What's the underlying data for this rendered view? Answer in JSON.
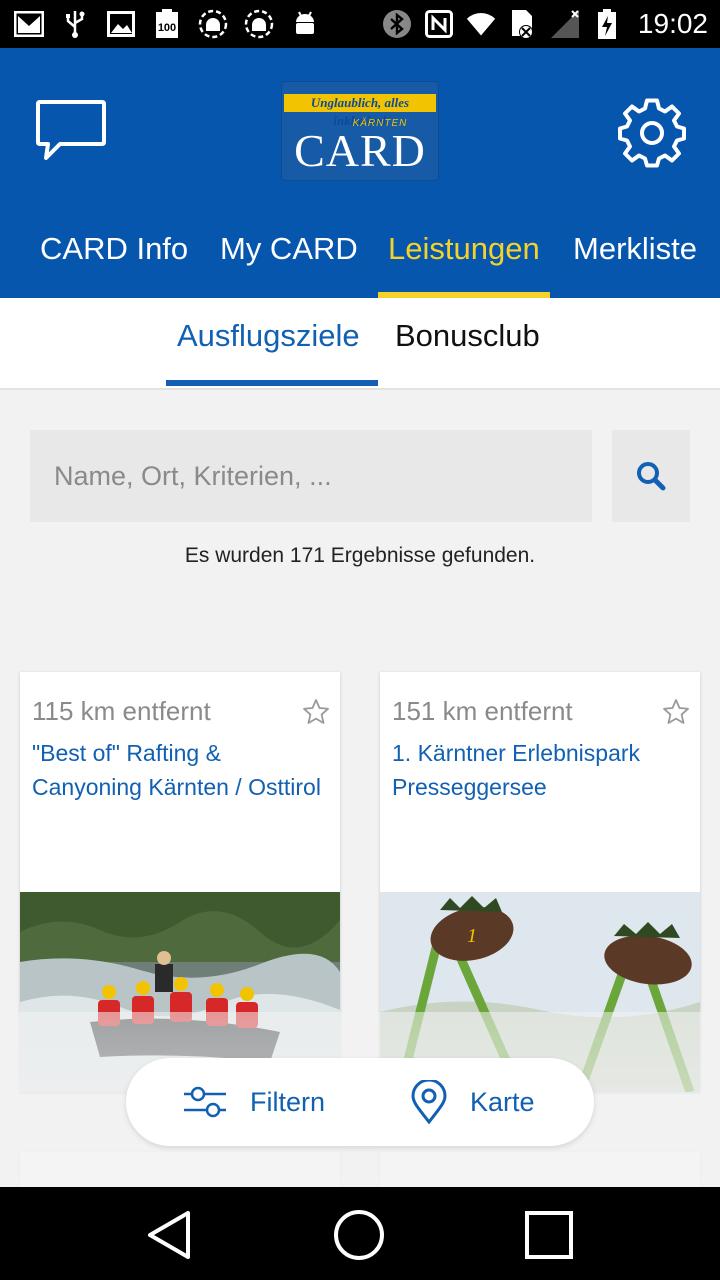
{
  "status_bar": {
    "time": "19:02",
    "icons": [
      "gmail-icon",
      "usb-icon",
      "image-icon",
      "battery-100-notification-icon",
      "android-debug-icon",
      "android-debug-icon",
      "android-icon",
      "bluetooth-icon",
      "nfc-icon",
      "wifi-icon",
      "sim-disabled-icon",
      "signal-icon",
      "battery-charging-icon"
    ]
  },
  "header": {
    "logo": {
      "slogan": "Unglaublich, alles inklusive!",
      "region": "KÄRNTEN",
      "brand": "CARD"
    },
    "tabs": [
      {
        "label": "CARD Info"
      },
      {
        "label": "My CARD"
      },
      {
        "label": "Leistungen",
        "active": true
      },
      {
        "label": "Merkliste"
      }
    ]
  },
  "sub_tabs": [
    {
      "label": "Ausflugsziele",
      "active": true
    },
    {
      "label": "Bonusclub"
    }
  ],
  "search": {
    "placeholder": "Name, Ort, Kriterien, ..."
  },
  "results": {
    "summary": "Es wurden 171 Ergebnisse gefunden."
  },
  "cards": [
    {
      "distance": "115 km entfernt",
      "title": "\"Best of\" Rafting & Canyoning Kärnten / Osttirol",
      "image": "rafting-photo"
    },
    {
      "distance": "151 km entfernt",
      "title": "1. Kärntner Erlebnispark Presseggersee",
      "image": "amusement-ride-photo"
    }
  ],
  "actions": {
    "filter_label": "Filtern",
    "map_label": "Karte"
  },
  "colors": {
    "brand_blue": "#0756ad",
    "accent_yellow": "#f5d22a",
    "link_blue": "#1160b3"
  }
}
